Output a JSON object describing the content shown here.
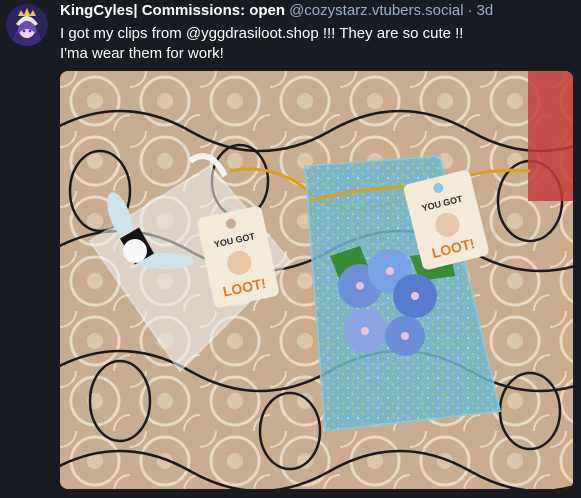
{
  "post": {
    "display_name": "KingCyles| Commissions: open",
    "handle": "@cozystarz.vtubers.social",
    "separator": "·",
    "timestamp": "3d",
    "lines": [
      "I got my clips from @yggdrasiloot.shop !!! They are so cute !!",
      "I'ma wear them for work!"
    ]
  },
  "media": {
    "tag_text_top": "YOU GOT",
    "tag_text_main": "LOOT!"
  },
  "colors": {
    "background": "#191b22",
    "name": "#ffffff",
    "meta": "#9baec8",
    "text": "#ffffff"
  }
}
